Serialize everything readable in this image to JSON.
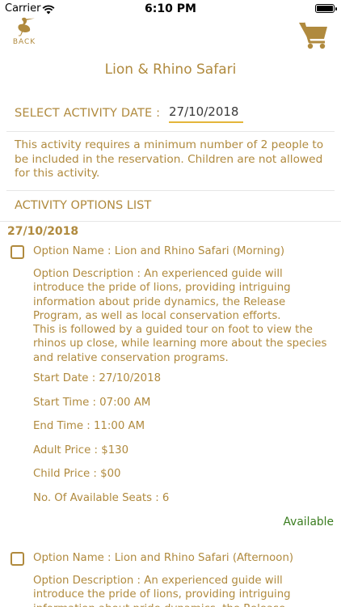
{
  "status_bar": {
    "carrier": "Carrier",
    "time": "6:10 PM"
  },
  "header": {
    "back_label": "BACK",
    "back_icon": "heron-bird-icon",
    "cart_icon": "shopping-cart-icon",
    "title": "Lion & Rhino Safari"
  },
  "activity_date": {
    "label": "SELECT ACTIVITY DATE :",
    "value": "27/10/2018"
  },
  "requirement_text": "This activity requires a minimum number of 2 people to be included in the reservation. Children are not allowed for this activity.",
  "options_list": {
    "header": "ACTIVITY OPTIONS LIST",
    "group_date": "27/10/2018",
    "options": [
      {
        "name": "Option Name : Lion and Rhino Safari (Morning)",
        "description": "Option Description : An experienced guide will introduce the pride of lions, providing intriguing information about pride dynamics, the Release Program, as well as local conservation efforts.\nThis is followed by a guided tour on foot to view the rhinos up close, while learning more about the species and relative conservation programs.",
        "start_date": "Start Date : 27/10/2018",
        "start_time": "Start Time : 07:00 AM",
        "end_time": "End Time : 11:00 AM",
        "adult_price": "Adult Price : $130",
        "child_price": "Child Price : $00",
        "seats": "No. Of Available Seats : 6",
        "status": "Available",
        "checked": false
      },
      {
        "name": "Option Name : Lion and Rhino Safari (Afternoon)",
        "description": "Option Description : An experienced guide will introduce the pride of lions, providing intriguing information about pride dynamics, the Release",
        "checked": false
      }
    ]
  },
  "colors": {
    "accent": "#b08a3e",
    "underline": "#e4b53a",
    "available": "#3a7d1f",
    "divider": "#e6e6e6"
  }
}
